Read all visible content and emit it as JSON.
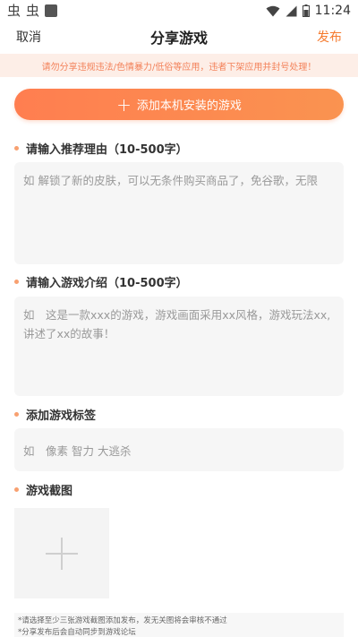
{
  "status_bar": {
    "left_glyph_1": "虫",
    "left_glyph_2": "虫",
    "time": "11:24"
  },
  "nav": {
    "cancel": "取消",
    "title": "分享游戏",
    "publish": "发布"
  },
  "warning": "请勿分享违规违法/色情暴力/低俗等应用，违者下架应用并封号处理！",
  "add_game_button": "添加本机安装的游戏",
  "sections": {
    "reason": {
      "label": "请输入推荐理由（10-500字）",
      "placeholder": "如 解锁了新的皮肤，可以无条件购买商品了，免谷歌，无限"
    },
    "intro": {
      "label": "请输入游戏介绍（10-500字）",
      "placeholder": "如　这是一款xxx的游戏，游戏画面采用xx风格，游戏玩法xx,讲述了xx的故事！"
    },
    "tags": {
      "label": "添加游戏标签",
      "placeholder": "如　像素 智力 大逃杀"
    },
    "screenshots": {
      "label": "游戏截图"
    }
  },
  "notes": [
    "*请选择至少三张游戏截图添加发布，发无关图将会审核不通过",
    "*分享发布后会自动同步到游戏论坛"
  ],
  "colors": {
    "accent": "#f57a2e",
    "banner_bg": "#fdeee7",
    "banner_text": "#f3825a",
    "button_start": "#ff7e50",
    "button_end": "#fa9350"
  }
}
